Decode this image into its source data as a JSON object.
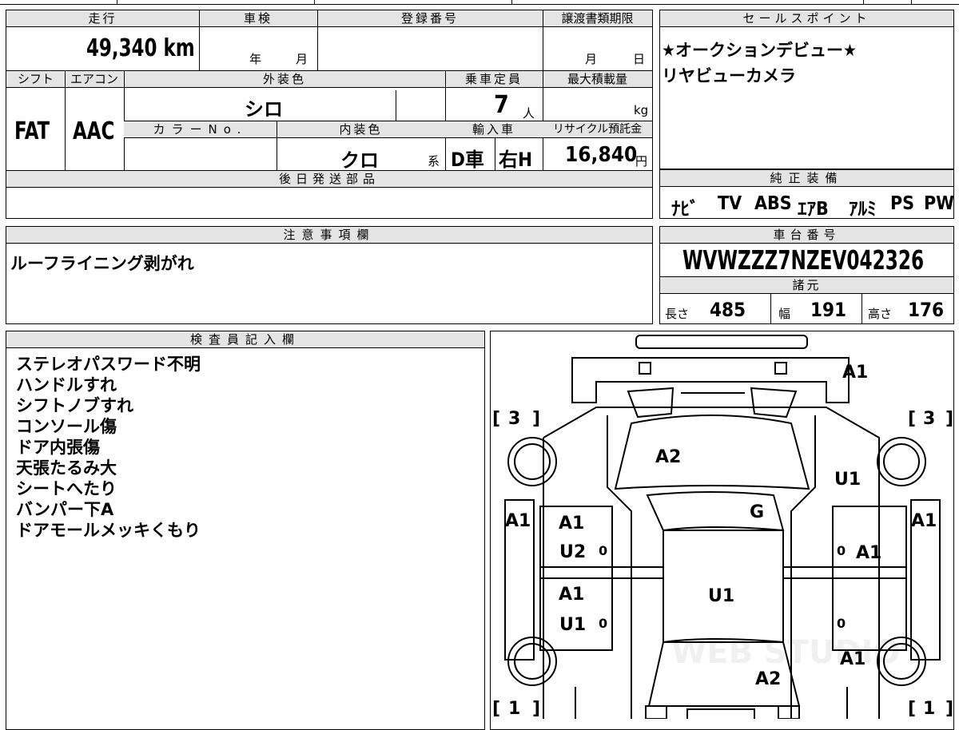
{
  "labels": {
    "mileage": "走行",
    "inspection": "車検",
    "registration": "登録番号",
    "transfer_deadline": "譲渡書類期限",
    "sales_points": "セールスポイント",
    "shift": "シフト",
    "aircon": "エアコン",
    "exterior_color": "外装色",
    "capacity": "乗車定員",
    "max_load": "最大積載量",
    "color_no": "カラーNo.",
    "interior_color": "内装色",
    "import": "輸入車",
    "recycle": "リサイクル預託金",
    "later_parts": "後日発送部品",
    "factory_equipment": "純正装備",
    "notes": "注意事項欄",
    "chassis": "車台番号",
    "specs": "諸元",
    "inspector": "検査員記入欄"
  },
  "values": {
    "mileage": "49,340 km",
    "inspection_year_unit": "年",
    "inspection_month_unit": "月",
    "transfer_month_unit": "月",
    "transfer_day_unit": "日",
    "shift": "FAT",
    "aircon": "AAC",
    "exterior_color": "シロ",
    "capacity": "7",
    "capacity_unit": "人",
    "load_unit": "kg",
    "interior_color": "クロ",
    "interior_suffix": "系",
    "import_type": "D車",
    "handle": "右H",
    "recycle": "16,840",
    "recycle_unit": "円",
    "chassis": "WVWZZZ7NZEV042326",
    "length_label": "長さ",
    "length": "485",
    "width_label": "幅",
    "width": "191",
    "height_label": "高さ",
    "height": "176"
  },
  "sales_points": [
    "★オークションデビュー★",
    "リヤビューカメラ"
  ],
  "equipment": [
    "ﾅﾋﾞ",
    "TV",
    "ABS",
    "ｴｱB",
    "ｱﾙﾐ",
    "PS",
    "PW"
  ],
  "notes_text": "ルーフライニング剥がれ",
  "inspector_notes": [
    "ステレオパスワード不明",
    "ハンドルすれ",
    "シフトノブすれ",
    "コンソール傷",
    "ドア内張傷",
    "天張たるみ大",
    "シートへたり",
    "バンパー下A",
    "ドアモールメッキくもり"
  ],
  "diagram": {
    "marks": {
      "front_bumper": "A1",
      "hood": "A2",
      "left_fender": "U1",
      "windshield": "G",
      "left_pillar": "A1",
      "right_pillar": "A1",
      "rf_door_a": "A1",
      "rf_door_u": "U2",
      "rr_door_a": "A1",
      "rr_door_u": "U1",
      "roof": "U1",
      "lf_door": "A1",
      "left_rear_quarter": "A1",
      "rear": "A2"
    },
    "tire_depth": {
      "tl": "3",
      "tr": "3",
      "bl": "1",
      "br": "1"
    },
    "zeros": [
      "0",
      "0",
      "0",
      "0"
    ],
    "watermark": "WEB STUDIO"
  }
}
